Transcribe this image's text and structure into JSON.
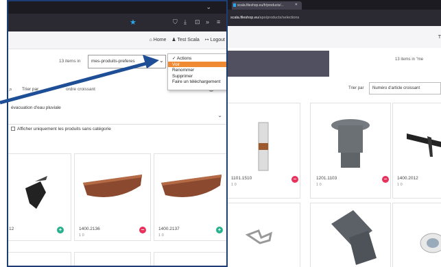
{
  "left_panel": {
    "header_links": {
      "home": "Home",
      "user": "Test Scala",
      "logout": "Logout"
    },
    "items_count": "13 items in",
    "list_select_value": "mes-produits-preferes",
    "actions_menu": {
      "title": "✓ Actions",
      "items": [
        "Voir",
        "Renommer",
        "Supprimer",
        "Faire un téléchargement"
      ],
      "selected": "Voir"
    },
    "sort": {
      "label": "Trier par",
      "value": "ordre croissant"
    },
    "category_value": "évacuation d'eau pluviale",
    "uncategorized_label": "Afficher uniquement les produits sans catégorie",
    "products": [
      {
        "code": "12",
        "meta": "",
        "badge": "plus"
      },
      {
        "code": "1400.2136",
        "meta": "1  0",
        "badge": "minus"
      },
      {
        "code": "1400.2137",
        "meta": "1  0",
        "badge": "plus"
      }
    ]
  },
  "right_panel": {
    "tab_title": "scala.fileshop.eu/fr/products/...",
    "url": {
      "host": "scala.fileshop.eu",
      "path": "/apo/products/selections"
    },
    "header_text": "T",
    "items_count": "13 items in \"me",
    "sort": {
      "label": "Trier par",
      "value": "Numéro d'article croissant"
    },
    "products": [
      {
        "code": "1101.1510",
        "meta": "1  0",
        "badge": "minus"
      },
      {
        "code": "1201.1103",
        "meta": "1  0",
        "badge": "minus"
      },
      {
        "code": "1400.2012",
        "meta": "1  0",
        "badge": ""
      }
    ]
  },
  "colors": {
    "accent_orange": "#f08a32",
    "annotation_blue": "#1e4f96",
    "frame_navy": "#1e3d75",
    "badge_red": "#e8315c",
    "badge_green": "#27b08c"
  }
}
